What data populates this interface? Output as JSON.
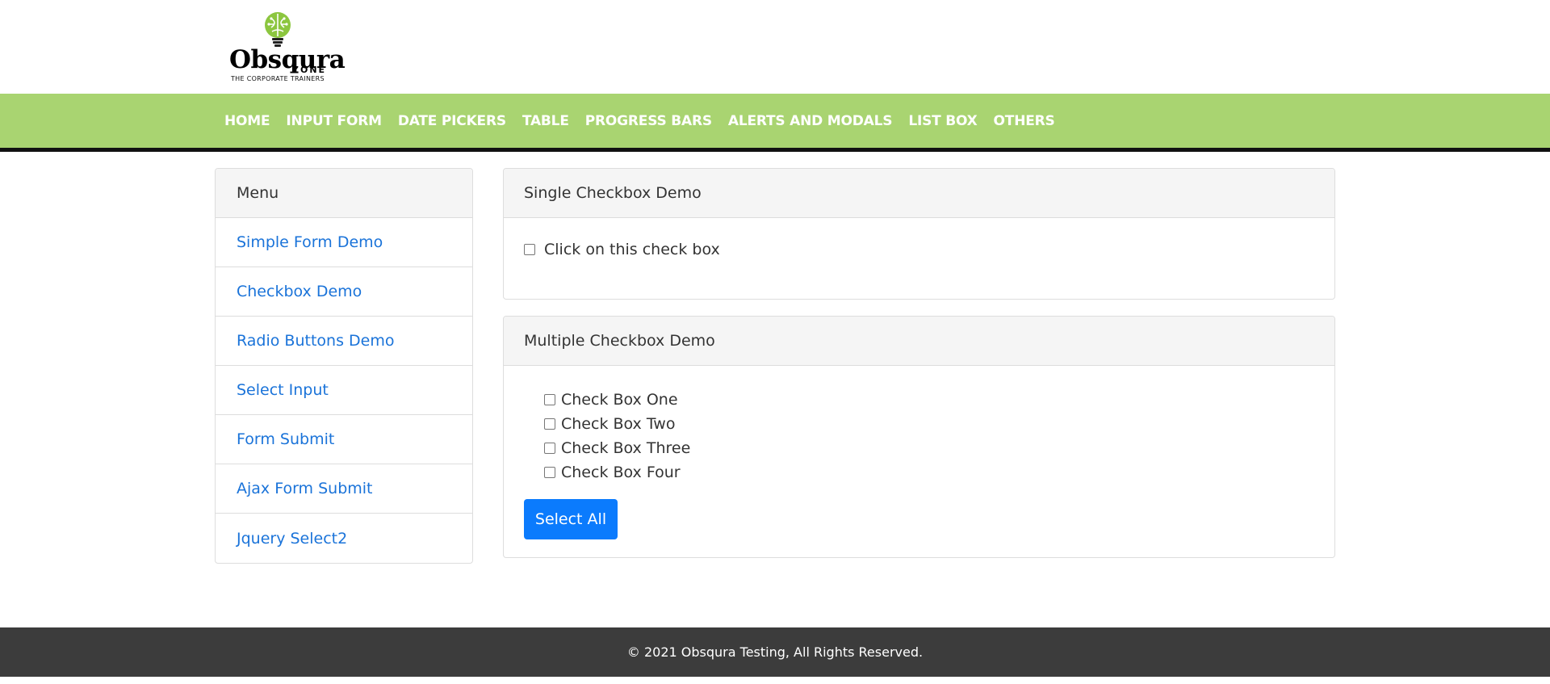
{
  "brand": {
    "name": "Obsqura",
    "sub": "ZONE",
    "tagline": "THE CORPORATE TRAINERS"
  },
  "nav": {
    "items": [
      {
        "label": "HOME"
      },
      {
        "label": "INPUT FORM"
      },
      {
        "label": "DATE PICKERS"
      },
      {
        "label": "TABLE"
      },
      {
        "label": "PROGRESS BARS"
      },
      {
        "label": "ALERTS AND MODALS"
      },
      {
        "label": "LIST BOX"
      },
      {
        "label": "OTHERS"
      }
    ]
  },
  "sidebar": {
    "title": "Menu",
    "items": [
      {
        "label": "Simple Form Demo"
      },
      {
        "label": "Checkbox Demo"
      },
      {
        "label": "Radio Buttons Demo"
      },
      {
        "label": "Select Input"
      },
      {
        "label": "Form Submit"
      },
      {
        "label": "Ajax Form Submit"
      },
      {
        "label": "Jquery Select2"
      }
    ]
  },
  "single": {
    "title": "Single Checkbox Demo",
    "checkbox_label": "Click on this check box"
  },
  "multiple": {
    "title": "Multiple Checkbox Demo",
    "checkboxes": [
      {
        "label": "Check Box One"
      },
      {
        "label": "Check Box Two"
      },
      {
        "label": "Check Box Three"
      },
      {
        "label": "Check Box Four"
      }
    ],
    "button_label": "Select All"
  },
  "footer": {
    "text": "© 2021 Obsqura Testing, All Rights Reserved."
  },
  "colors": {
    "nav_bg": "#a9d471",
    "link": "#1a73d9",
    "primary": "#0b7bfd",
    "footer_bg": "#3c3c3c"
  }
}
